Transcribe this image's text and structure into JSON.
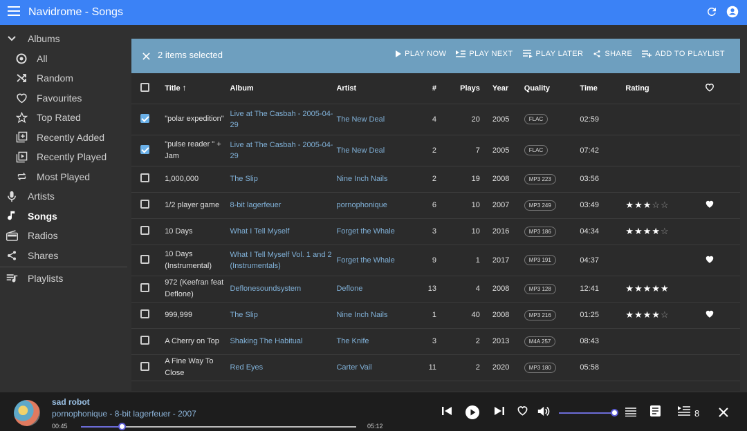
{
  "app": {
    "title": "Navidrome - Songs"
  },
  "sidebar": {
    "albums_label": "Albums",
    "album_items": [
      {
        "label": "All",
        "icon": "all-icon"
      },
      {
        "label": "Random",
        "icon": "shuffle-icon"
      },
      {
        "label": "Favourites",
        "icon": "heart-outline-icon"
      },
      {
        "label": "Top Rated",
        "icon": "star-outline-icon"
      },
      {
        "label": "Recently Added",
        "icon": "library-add-icon"
      },
      {
        "label": "Recently Played",
        "icon": "video-library-icon"
      },
      {
        "label": "Most Played",
        "icon": "repeat-icon"
      }
    ],
    "items": [
      {
        "label": "Artists",
        "icon": "microphone-icon"
      },
      {
        "label": "Songs",
        "icon": "music-note-icon"
      },
      {
        "label": "Radios",
        "icon": "radio-icon"
      },
      {
        "label": "Shares",
        "icon": "share-icon"
      }
    ],
    "playlists_label": "Playlists"
  },
  "selection": {
    "count_text": "2 items selected",
    "actions": [
      "PLAY NOW",
      "PLAY NEXT",
      "PLAY LATER",
      "SHARE",
      "ADD TO PLAYLIST"
    ]
  },
  "table": {
    "headers": {
      "title": "Title",
      "album": "Album",
      "artist": "Artist",
      "num": "#",
      "plays": "Plays",
      "year": "Year",
      "quality": "Quality",
      "time": "Time",
      "rating": "Rating"
    },
    "rows": [
      {
        "checked": true,
        "title": "\"polar expedition\"",
        "album": "Live at The Casbah - 2005-04-29",
        "artist": "The New Deal",
        "num": "4",
        "plays": "20",
        "year": "2005",
        "quality": "FLAC",
        "time": "02:59",
        "rating": 0,
        "loved": false
      },
      {
        "checked": true,
        "title": "\"pulse reader \" + Jam",
        "album": "Live at The Casbah - 2005-04-29",
        "artist": "The New Deal",
        "num": "2",
        "plays": "7",
        "year": "2005",
        "quality": "FLAC",
        "time": "07:42",
        "rating": 0,
        "loved": false
      },
      {
        "checked": false,
        "title": "1,000,000",
        "album": "The Slip",
        "artist": "Nine Inch Nails",
        "num": "2",
        "plays": "19",
        "year": "2008",
        "quality": "MP3 223",
        "time": "03:56",
        "rating": 0,
        "loved": false
      },
      {
        "checked": false,
        "title": "1/2 player game",
        "album": "8-bit lagerfeuer",
        "artist": "pornophonique",
        "num": "6",
        "plays": "10",
        "year": "2007",
        "quality": "MP3 249",
        "time": "03:49",
        "rating": 3,
        "loved": true
      },
      {
        "checked": false,
        "title": "10 Days",
        "album": "What I Tell Myself",
        "artist": "Forget the Whale",
        "num": "3",
        "plays": "10",
        "year": "2016",
        "quality": "MP3 186",
        "time": "04:34",
        "rating": 4,
        "loved": false
      },
      {
        "checked": false,
        "title": "10 Days (Instrumental)",
        "album": "What I Tell Myself Vol. 1 and 2 (Instrumentals)",
        "artist": "Forget the Whale",
        "num": "9",
        "plays": "1",
        "year": "2017",
        "quality": "MP3 191",
        "time": "04:37",
        "rating": 0,
        "loved": true
      },
      {
        "checked": false,
        "title": "972 (Keefran feat Deflone)",
        "album": "Deflonesoundsystem",
        "artist": "Deflone",
        "num": "13",
        "plays": "4",
        "year": "2008",
        "quality": "MP3 128",
        "time": "12:41",
        "rating": 5,
        "loved": false
      },
      {
        "checked": false,
        "title": "999,999",
        "album": "The Slip",
        "artist": "Nine Inch Nails",
        "num": "1",
        "plays": "40",
        "year": "2008",
        "quality": "MP3 216",
        "time": "01:25",
        "rating": 4,
        "loved": true
      },
      {
        "checked": false,
        "title": "A Cherry on Top",
        "album": "Shaking The Habitual",
        "artist": "The Knife",
        "num": "3",
        "plays": "2",
        "year": "2013",
        "quality": "M4A 257",
        "time": "08:43",
        "rating": 0,
        "loved": false
      },
      {
        "checked": false,
        "title": "A Fine Way To Close",
        "album": "Red Eyes",
        "artist": "Carter Vail",
        "num": "11",
        "plays": "2",
        "year": "2020",
        "quality": "MP3 180",
        "time": "05:58",
        "rating": 0,
        "loved": false
      }
    ]
  },
  "player": {
    "song": "sad robot",
    "artist_album": "pornophonique - 8-bit lagerfeuer - 2007",
    "elapsed": "00:45",
    "duration": "05:12",
    "progress_fraction": 0.15,
    "volume_fraction": 1.0,
    "queue_count": "8"
  },
  "colors": {
    "appbar": "#3b82f6",
    "selection_bar": "#6e9fbf",
    "link": "#80b1d8",
    "accent": "#5b5bd6"
  }
}
